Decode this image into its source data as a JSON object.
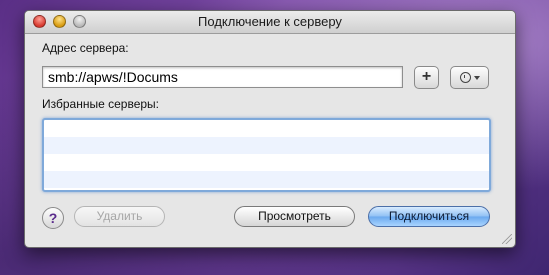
{
  "window": {
    "title": "Подключение к серверу"
  },
  "server_address": {
    "label": "Адрес сервера:",
    "value": "smb://apws/!Docums",
    "add_button_icon": "plus-icon",
    "recent_button_icon": "clock-icon"
  },
  "favorites": {
    "label": "Избранные серверы:",
    "items": []
  },
  "buttons": {
    "help": "?",
    "delete": "Удалить",
    "browse": "Просмотреть",
    "connect": "Подключиться"
  },
  "colors": {
    "accent": "#6aa8ee",
    "list_focus_border": "#7fa9da",
    "alt_row": "#edf3fe"
  }
}
